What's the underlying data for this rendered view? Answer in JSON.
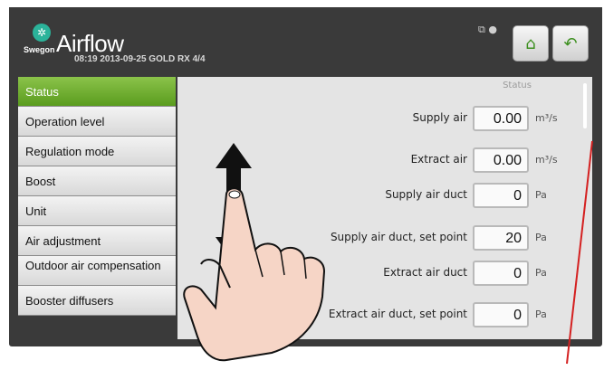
{
  "header": {
    "title": "Airflow",
    "brand": "Swegon",
    "subtitle": "08:19 2013-09-25  GOLD RX  4/4",
    "status_icons": "⧉ ●",
    "home_icon": "home-icon",
    "back_icon": "back-arrow-icon"
  },
  "sidebar": {
    "items": [
      {
        "label": "Status"
      },
      {
        "label": "Operation level"
      },
      {
        "label": "Regulation mode"
      },
      {
        "label": "Boost"
      },
      {
        "label": "Unit"
      },
      {
        "label": "Air adjustment"
      },
      {
        "label": "Outdoor air compensation"
      },
      {
        "label": "Booster diffusers"
      }
    ]
  },
  "content": {
    "title": "Status",
    "rows": [
      {
        "label": "Supply air",
        "value": "0.00",
        "unit": "m³/s"
      },
      {
        "label": "Extract air",
        "value": "0.00",
        "unit": "m³/s"
      },
      {
        "label": "Supply air duct",
        "value": "0",
        "unit": "Pa"
      },
      {
        "label": "Supply air duct, set point",
        "value": "20",
        "unit": "Pa"
      },
      {
        "label": "Extract air duct",
        "value": "0",
        "unit": "Pa"
      },
      {
        "label": "Extract air duct, set point",
        "value": "0",
        "unit": "Pa"
      }
    ]
  },
  "colors": {
    "accent": "#6aab2a",
    "logo": "#2bb39a",
    "frame": "#3a3a3a"
  }
}
